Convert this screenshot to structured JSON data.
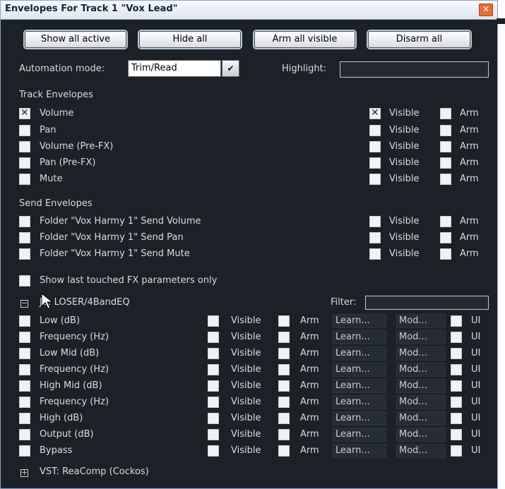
{
  "window": {
    "title": "Envelopes For Track 1 \"Vox Lead\"",
    "close_glyph": "✕"
  },
  "buttons": {
    "show_all_active": "Show all active",
    "hide_all": "Hide all",
    "arm_all_visible": "Arm all visible",
    "disarm_all": "Disarm all"
  },
  "automation": {
    "label": "Automation mode:",
    "value": "Trim/Read",
    "highlight_label": "Highlight:"
  },
  "track_envelopes": {
    "heading": "Track Envelopes",
    "items": [
      {
        "label": "Volume",
        "checked": true,
        "visible": true,
        "arm": false
      },
      {
        "label": "Pan",
        "checked": false,
        "visible": false,
        "arm": false
      },
      {
        "label": "Volume (Pre-FX)",
        "checked": false,
        "visible": false,
        "arm": false
      },
      {
        "label": "Pan (Pre-FX)",
        "checked": false,
        "visible": false,
        "arm": false
      },
      {
        "label": "Mute",
        "checked": false,
        "visible": false,
        "arm": false
      }
    ]
  },
  "send_envelopes": {
    "heading": "Send Envelopes",
    "items": [
      {
        "label": "Folder \"Vox Harmy 1\" Send Volume"
      },
      {
        "label": "Folder \"Vox Harmy 1\" Send Pan"
      },
      {
        "label": "Folder \"Vox Harmy 1\" Send Mute"
      }
    ]
  },
  "common": {
    "visible": "Visible",
    "arm": "Arm",
    "learn": "Learn...",
    "mod": "Mod...",
    "ui": "UI"
  },
  "show_last_touched": "Show last touched FX parameters only",
  "fx": {
    "name": "JS: LOSER/4BandEQ",
    "filter_label": "Filter:",
    "params": [
      "Low (dB)",
      "Frequency (Hz)",
      "Low Mid (dB)",
      "Frequency (Hz)",
      "High Mid (dB)",
      "Frequency (Hz)",
      "High (dB)",
      "Output (dB)",
      "Bypass"
    ],
    "collapse_glyph": "−",
    "expand_glyph": "+"
  },
  "vst": {
    "name": "VST: ReaComp (Cockos)"
  }
}
